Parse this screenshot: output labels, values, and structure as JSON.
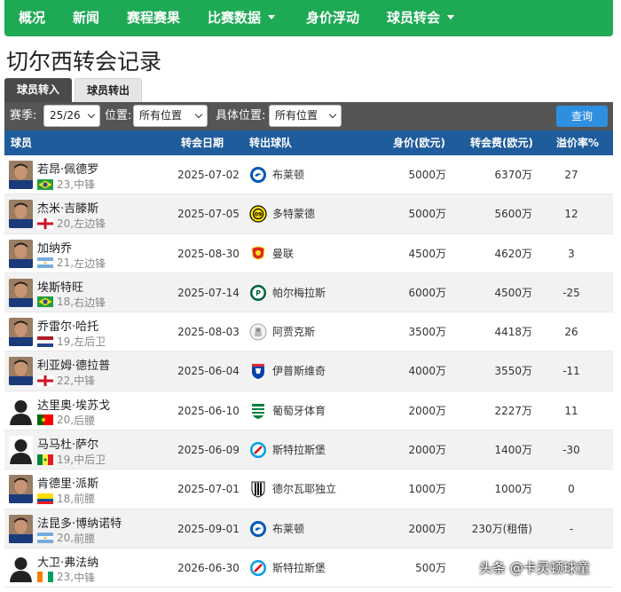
{
  "nav": {
    "items": [
      {
        "label": "概况",
        "dropdown": false
      },
      {
        "label": "新闻",
        "dropdown": false
      },
      {
        "label": "赛程赛果",
        "dropdown": false
      },
      {
        "label": "比赛数据",
        "dropdown": true
      },
      {
        "label": "身价浮动",
        "dropdown": false
      },
      {
        "label": "球员转会",
        "dropdown": true
      }
    ]
  },
  "page_title": "切尔西转会记录",
  "tabs": [
    {
      "label": "球员转入",
      "active": true
    },
    {
      "label": "球员转出",
      "active": false
    }
  ],
  "filters": {
    "season_label": "赛季:",
    "season_value": "25/26",
    "position_label": "位置:",
    "position_value": "所有位置",
    "detail_position_label": "具体位置:",
    "detail_position_value": "所有位置",
    "query_button": "查询"
  },
  "table": {
    "headers": [
      "球员",
      "转会日期",
      "转出球队",
      "身价(欧元)",
      "转会费(欧元)",
      "溢价率%"
    ],
    "rows": [
      {
        "name": "若昂·佩德罗",
        "age": "23",
        "position": "中锋",
        "nation": "brazil-flag",
        "date": "2025-07-02",
        "club": "布莱顿",
        "club_icon": "brighton-crest-icon",
        "value": "5000万",
        "fee": "6370万",
        "premium": "27"
      },
      {
        "name": "杰米·吉滕斯",
        "age": "20",
        "position": "左边锋",
        "nation": "england-flag",
        "date": "2025-07-05",
        "club": "多特蒙德",
        "club_icon": "dortmund-crest-icon",
        "value": "5000万",
        "fee": "5600万",
        "premium": "12"
      },
      {
        "name": "加纳乔",
        "age": "21",
        "position": "左边锋",
        "nation": "argentina-flag",
        "date": "2025-08-30",
        "club": "曼联",
        "club_icon": "man-utd-crest-icon",
        "value": "4500万",
        "fee": "4620万",
        "premium": "3"
      },
      {
        "name": "埃斯特旺",
        "age": "18",
        "position": "右边锋",
        "nation": "brazil-flag",
        "date": "2025-07-14",
        "club": "帕尔梅拉斯",
        "club_icon": "palmeiras-crest-icon",
        "value": "6000万",
        "fee": "4500万",
        "premium": "-25"
      },
      {
        "name": "乔雷尔·哈托",
        "age": "19",
        "position": "左后卫",
        "nation": "netherlands-flag",
        "date": "2025-08-03",
        "club": "阿贾克斯",
        "club_icon": "ajax-crest-icon",
        "value": "3500万",
        "fee": "4418万",
        "premium": "26"
      },
      {
        "name": "利亚姆·德拉普",
        "age": "22",
        "position": "中锋",
        "nation": "england-flag",
        "date": "2025-06-04",
        "club": "伊普斯维奇",
        "club_icon": "ipswich-crest-icon",
        "value": "4000万",
        "fee": "3550万",
        "premium": "-11"
      },
      {
        "name": "达里奥·埃苏戈",
        "age": "20",
        "position": "后腰",
        "nation": "portugal-flag",
        "date": "2025-06-10",
        "club": "葡萄牙体育",
        "club_icon": "sporting-crest-icon",
        "value": "2000万",
        "fee": "2227万",
        "premium": "11"
      },
      {
        "name": "马马杜·萨尔",
        "age": "19",
        "position": "中后卫",
        "nation": "senegal-flag",
        "date": "2025-06-09",
        "club": "斯特拉斯堡",
        "club_icon": "strasbourg-crest-icon",
        "value": "2000万",
        "fee": "1400万",
        "premium": "-30"
      },
      {
        "name": "肯德里·派斯",
        "age": "18",
        "position": "前腰",
        "nation": "ecuador-flag",
        "date": "2025-07-01",
        "club": "德尔瓦耶独立",
        "club_icon": "idv-crest-icon",
        "value": "1000万",
        "fee": "1000万",
        "premium": "0"
      },
      {
        "name": "法昆多·博纳诺特",
        "age": "20",
        "position": "前腰",
        "nation": "argentina-flag",
        "date": "2025-09-01",
        "club": "布莱顿",
        "club_icon": "brighton-crest-icon",
        "value": "2000万",
        "fee": "230万(租借)",
        "premium": "-"
      },
      {
        "name": "大卫·弗法纳",
        "age": "23",
        "position": "中锋",
        "nation": "ivory-coast-flag",
        "date": "2026-06-30",
        "club": "斯特拉斯堡",
        "club_icon": "strasbourg-crest-icon",
        "value": "500万",
        "fee": "",
        "premium": ""
      }
    ]
  },
  "watermark": "头条 @卡灵顿球童",
  "colors": {
    "nav": "#1eaa55",
    "header": "#1f5c9c",
    "filterbar": "#555555",
    "query": "#2e8fe0"
  }
}
